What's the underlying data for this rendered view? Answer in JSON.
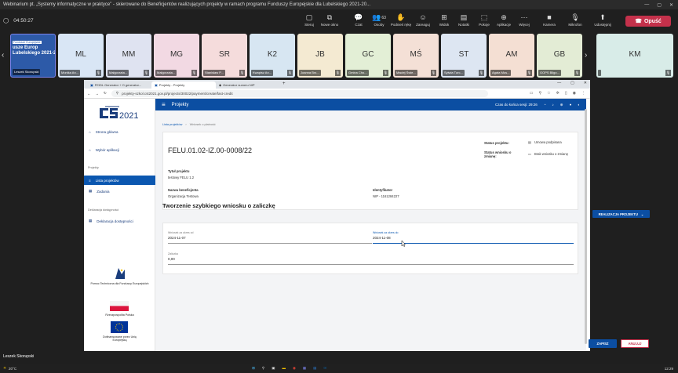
{
  "teams": {
    "title": "Webinarium pt. „Systemy informatyczne w praktyce” - skierowane do Beneficjentów realizujących projekty w ramach programu Funduszy Europejskie dla Lubelskiego 2021-20...",
    "timer": "04:50:27",
    "toolbar": [
      {
        "label": "Steruj",
        "icon": "▢"
      },
      {
        "label": "Nowe okno",
        "icon": "⧉"
      },
      {
        "label": "Czat",
        "icon": "💬"
      },
      {
        "label": "Osoby",
        "icon": "👥",
        "count": "63"
      },
      {
        "label": "Podnieś rękę",
        "icon": "✋"
      },
      {
        "label": "Zareaguj",
        "icon": "☺"
      },
      {
        "label": "Widok",
        "icon": "⊞"
      },
      {
        "label": "Notatki",
        "icon": "▤"
      },
      {
        "label": "Pokoje",
        "icon": "⬚"
      },
      {
        "label": "Aplikacje",
        "icon": "⊕"
      },
      {
        "label": "Więcej",
        "icon": "⋯"
      },
      {
        "label": "Kamera",
        "icon": "■"
      },
      {
        "label": "Mikrofon",
        "icon": "🎙"
      },
      {
        "label": "Udostępnij",
        "icon": "⬆"
      }
    ],
    "leave_label": "Opuść",
    "participants": [
      {
        "initials": "",
        "name": "Leszek Skorupski",
        "color": "#2d5aa8"
      },
      {
        "initials": "ML",
        "name": "Monika An...",
        "color": "#d9e6f5"
      },
      {
        "initials": "MM",
        "name": "Małgorzata...",
        "color": "#dfe3f1"
      },
      {
        "initials": "MG",
        "name": "Małgorzata...",
        "color": "#f2d9e3"
      },
      {
        "initials": "SR",
        "name": "Stanisław P...",
        "color": "#f5dcdc"
      },
      {
        "initials": "K2",
        "name": "Kwapisz An...",
        "color": "#d7e6f2"
      },
      {
        "initials": "JB",
        "name": "Joanna Brz...",
        "color": "#f4ead2"
      },
      {
        "initials": "GC",
        "name": "Gmina Cho...",
        "color": "#e3efd6"
      },
      {
        "initials": "MŚ",
        "name": "Maciej Świe...",
        "color": "#f4e0d6"
      },
      {
        "initials": "ST",
        "name": "Sylwia Turc...",
        "color": "#dde6f2"
      },
      {
        "initials": "AM",
        "name": "Agata Mus...",
        "color": "#f4dfd3"
      },
      {
        "initials": "GB",
        "name": "GOPS Biłgo...",
        "color": "#e3ecd5"
      },
      {
        "initials": "KM",
        "name": "",
        "color": "#d8ece8"
      }
    ],
    "presenter_banner": "usze Europ Lubelskiego 2021-2",
    "presenter_small": "Fundusze Europejskie",
    "bottom_name": "Leszek Skorupski"
  },
  "browser": {
    "tabs": [
      "FEIDL Generator + O generator...",
      "Projekty - Projekty",
      "Generator numeru NIP"
    ],
    "new_tab": "+",
    "url": "projekty-szkol.cst2021.gov.pl/projects/30022/payment/create/fast-credit"
  },
  "app": {
    "logo_text": "2021",
    "header_title": "Projekty",
    "session_label": "Czas do końca sesji: 29:26",
    "sidebar": {
      "items": [
        {
          "label": "Strona główna",
          "icon": "⌂"
        },
        {
          "label": "Wybór aplikacji",
          "icon": "⌂"
        }
      ],
      "section1": "Projekty",
      "projects_items": [
        {
          "label": "Lista projektów",
          "icon": "≡",
          "active": true
        },
        {
          "label": "Zadania",
          "icon": "▦"
        }
      ],
      "section2": "Deklaracja dostępności",
      "decl_item": {
        "label": "Deklaracja dostępności",
        "icon": "▦"
      },
      "fe_logos": [
        "Pomoc Techniczna dla Funduszy Europejskich",
        "Rzeczpospolita Polska",
        "Dofinansowane przez Unię Europejską"
      ]
    },
    "breadcrumb": {
      "link": "Lista projektów",
      "current": "Wniosek o płatność"
    },
    "project": {
      "id": "FELU.01.02-IZ.00-0008/22",
      "title_label": "Tytuł projektu",
      "title_value": "testowy FELU 1.2",
      "beneficiary_label": "Nazwa beneficjenta",
      "beneficiary_value": "Organizacja Testowa",
      "identifier_label": "Identyfikator",
      "identifier_value": "NIP - 1161284227",
      "status_project_label": "Status projektu:",
      "status_project_value": "Umowa podpisana",
      "status_application_label": "Status wniosku o zmianę:",
      "status_application_value": "Brak wniosku o zmianę"
    },
    "form": {
      "title": "Tworzenie szybkiego wniosku o zaliczkę",
      "realization_button": "REALIZACJA PROJEKTU",
      "date_from_label": "Wniosek za okres od",
      "date_from_value": "2024-11-07",
      "date_to_label": "Wniosek za okres do",
      "date_to_value": "2024-11-08",
      "advance_label": "Zaliczka",
      "advance_value": "0,00",
      "save": "ZAPISZ",
      "cancel": "ANULUJ"
    }
  },
  "taskbar": {
    "weather": "20°C",
    "clock": "12:29"
  }
}
